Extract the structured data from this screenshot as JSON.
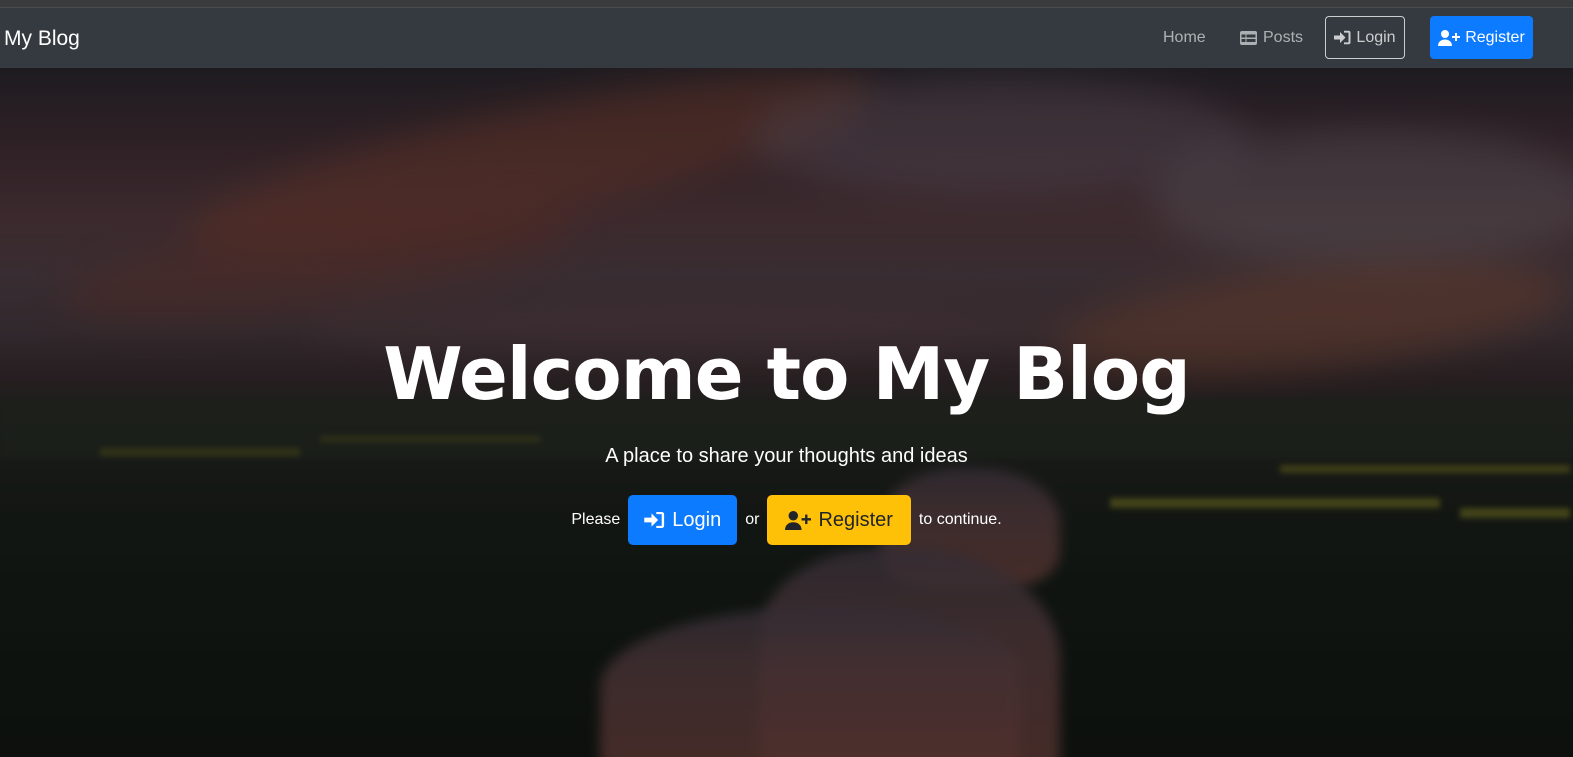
{
  "navbar": {
    "brand": "My Blog",
    "home_label": "Home",
    "posts_label": "Posts",
    "login_label": "Login",
    "register_label": "Register"
  },
  "hero": {
    "title": "Welcome to My Blog",
    "subtitle": "A place to share your thoughts and ideas",
    "prefix_text": "Please",
    "login_label": "Login",
    "connector_text": "or",
    "register_label": "Register",
    "suffix_text": "to continue."
  },
  "icons": {
    "posts": "table-icon",
    "login": "sign-in-icon",
    "register": "user-plus-icon"
  },
  "colors": {
    "navbar_bg": "#343a40",
    "primary": "#0d7bff",
    "warning": "#ffc107"
  }
}
